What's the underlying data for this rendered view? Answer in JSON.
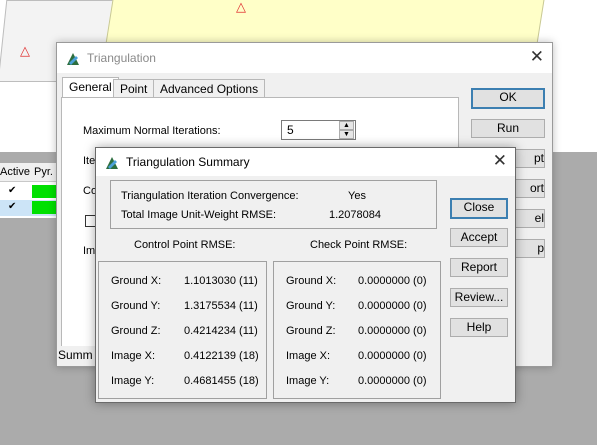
{
  "background": {
    "cell_list": {
      "headers": [
        "Active",
        "Pyr."
      ],
      "rows": [
        {
          "active": "✔",
          "selected": false
        },
        {
          "active": "✔",
          "selected": true
        }
      ]
    },
    "status_text": "Summ"
  },
  "triangulation_dialog": {
    "title": "Triangulation",
    "tabs": [
      "General",
      "Point",
      "Advanced Options"
    ],
    "selected_tab": "General",
    "max_iterations_label": "Maximum Normal Iterations:",
    "max_iterations_value": "5",
    "partial_labels": [
      "Ite",
      "Co",
      "Im"
    ],
    "buttons": {
      "ok": "OK",
      "run": "Run",
      "accept_partial": "pt",
      "report_partial": "ort",
      "cancel_partial": "el",
      "help_partial": "p"
    }
  },
  "summary_dialog": {
    "title": "Triangulation Summary",
    "convergence_label": "Triangulation Iteration Convergence:",
    "convergence_value": "Yes",
    "rmse_label": "Total Image Unit-Weight RMSE:",
    "rmse_value": "1.2078084",
    "control_header": "Control Point RMSE:",
    "check_header": "Check Point RMSE:",
    "control_rows": [
      {
        "label": "Ground X:",
        "value": "1.1013030 (11)"
      },
      {
        "label": "Ground Y:",
        "value": "1.3175534 (11)"
      },
      {
        "label": "Ground Z:",
        "value": "0.4214234 (11)"
      },
      {
        "label": "Image X:",
        "value": "0.4122139 (18)"
      },
      {
        "label": "Image Y:",
        "value": "0.4681455 (18)"
      }
    ],
    "check_rows": [
      {
        "label": "Ground X:",
        "value": "0.0000000 (0)"
      },
      {
        "label": "Ground Y:",
        "value": "0.0000000 (0)"
      },
      {
        "label": "Ground Z:",
        "value": "0.0000000 (0)"
      },
      {
        "label": "Image X:",
        "value": "0.0000000 (0)"
      },
      {
        "label": "Image Y:",
        "value": "0.0000000 (0)"
      }
    ],
    "buttons": {
      "close": "Close",
      "accept": "Accept",
      "report": "Report",
      "review": "Review...",
      "help": "Help"
    }
  },
  "colors": {
    "default_button_border": "#3c7fb1",
    "green_indicator": "#00e000",
    "footprint_yellow": "#ffffc8",
    "triangle_red": "#e03030"
  }
}
